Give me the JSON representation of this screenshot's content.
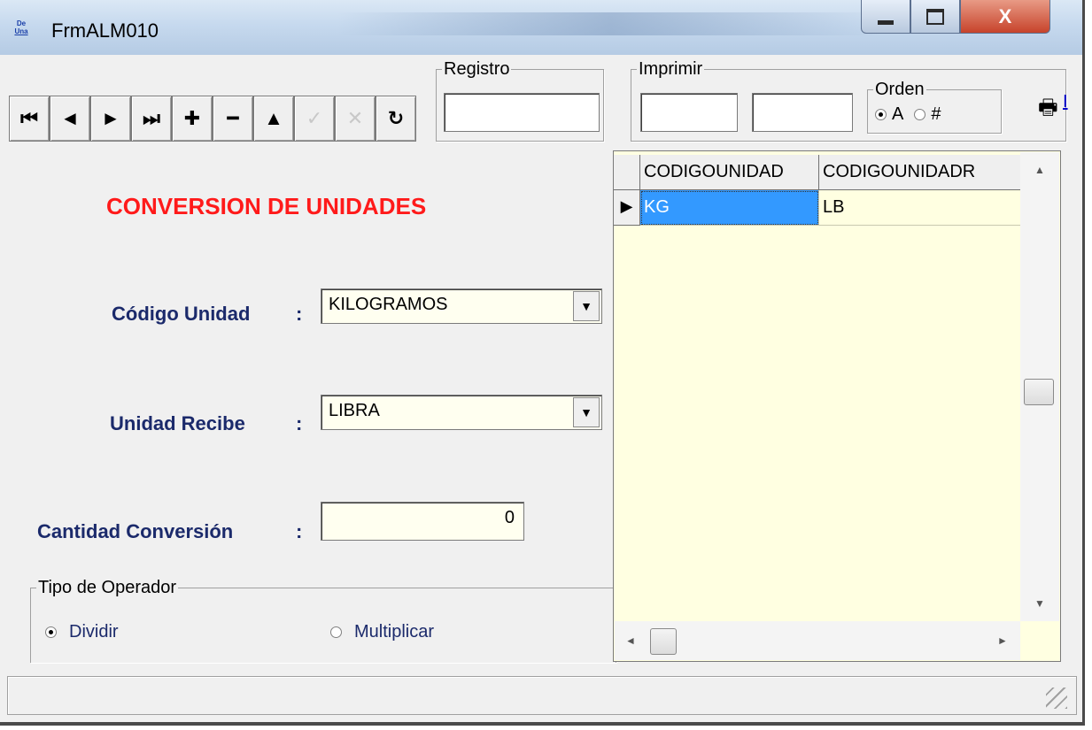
{
  "window": {
    "title": "FrmALM010",
    "icon_text_top": "De",
    "icon_text_bottom": "Una",
    "close_glyph": "X"
  },
  "toolbar": {
    "buttons": [
      {
        "name": "first-record-button",
        "glyph": "⏮",
        "enabled": true
      },
      {
        "name": "prev-record-button",
        "glyph": "◄",
        "enabled": true
      },
      {
        "name": "next-record-button",
        "glyph": "►",
        "enabled": true
      },
      {
        "name": "last-record-button",
        "glyph": "⏭",
        "enabled": true
      },
      {
        "name": "add-record-button",
        "glyph": "✚",
        "enabled": true
      },
      {
        "name": "delete-record-button",
        "glyph": "━",
        "enabled": true
      },
      {
        "name": "edit-record-button",
        "glyph": "▲",
        "enabled": true
      },
      {
        "name": "confirm-button",
        "glyph": "✓",
        "enabled": false
      },
      {
        "name": "cancel-button",
        "glyph": "✕",
        "enabled": false
      },
      {
        "name": "refresh-button",
        "glyph": "↻",
        "enabled": true
      }
    ],
    "registro_label": "Registro",
    "registro_value": "",
    "imprimir_label": "Imprimir",
    "imprimir_from": "",
    "imprimir_to": "",
    "orden_label": "Orden",
    "orden_options": [
      "A",
      "#"
    ],
    "orden_selected": "A",
    "print_icon": "printer-icon",
    "print_link": "I"
  },
  "form": {
    "title": "CONVERSION DE UNIDADES",
    "codigo_unidad_label": "Código Unidad",
    "codigo_unidad_value": "KILOGRAMOS",
    "unidad_recibe_label": "Unidad Recibe",
    "unidad_recibe_value": "LIBRA",
    "cantidad_label": "Cantidad Conversión",
    "cantidad_value": "0",
    "colon": ":",
    "operador_group_label": "Tipo de Operador",
    "operador_options": [
      "Dividir",
      "Multiplicar"
    ],
    "operador_selected": "Dividir"
  },
  "grid": {
    "columns": [
      "CODIGOUNIDAD",
      "CODIGOUNIDADR"
    ],
    "rows": [
      [
        "KG",
        "LB"
      ]
    ],
    "selected_row": 0
  },
  "colors": {
    "title_red": "#ff1a1a",
    "label_navy": "#1b2a6b",
    "field_bg": "#fffff0",
    "grid_bg": "#ffffe1",
    "selection": "#3399ff"
  }
}
